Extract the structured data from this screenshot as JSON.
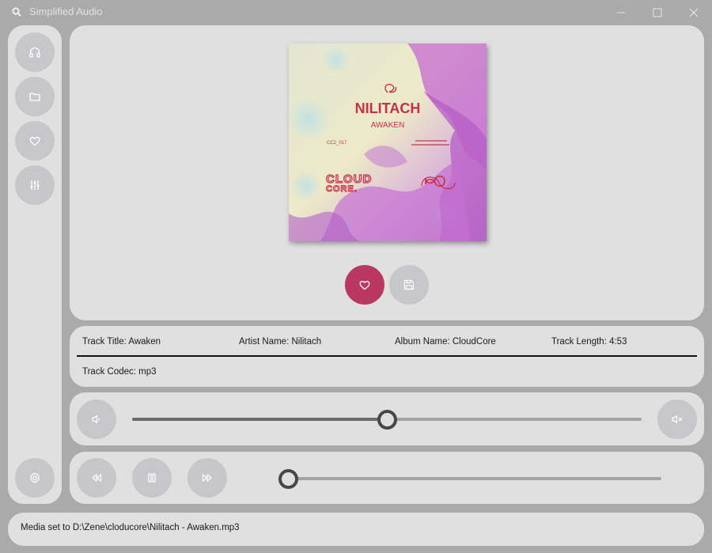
{
  "window": {
    "title": "Simplified Audio",
    "icon": "search-icon"
  },
  "sidebar": {
    "items": [
      {
        "icon": "headphones-icon"
      },
      {
        "icon": "folder-icon"
      },
      {
        "icon": "heart-icon"
      },
      {
        "icon": "sliders-icon"
      }
    ],
    "settings_icon": "gear-icon"
  },
  "album_art": {
    "artist": "NILITACH",
    "track": "AWAKEN",
    "catalog": "CC2_017",
    "label_logo": "CLOUD CORE."
  },
  "actions": {
    "favorite_icon": "heart-icon",
    "favorite_color": "#b8385f",
    "save_icon": "save-icon"
  },
  "track_info": {
    "title": "Track Title: Awaken",
    "artist": "Artist Name: Nilitach",
    "album": "Album Name: CloudCore",
    "length": "Track Length: 4:53",
    "codec": "Track Codec: mp3"
  },
  "volume": {
    "level_fraction": 0.5,
    "low_icon": "volume-low-icon",
    "mute_icon": "mute-icon"
  },
  "transport": {
    "rewind_icon": "rewind-icon",
    "pause_icon": "pause-icon",
    "forward_icon": "fast-forward-icon",
    "progress_fraction": 0.0
  },
  "status": {
    "message": "Media set to D:\\Zene\\cloducore\\Nilitach - Awaken.mp3"
  }
}
